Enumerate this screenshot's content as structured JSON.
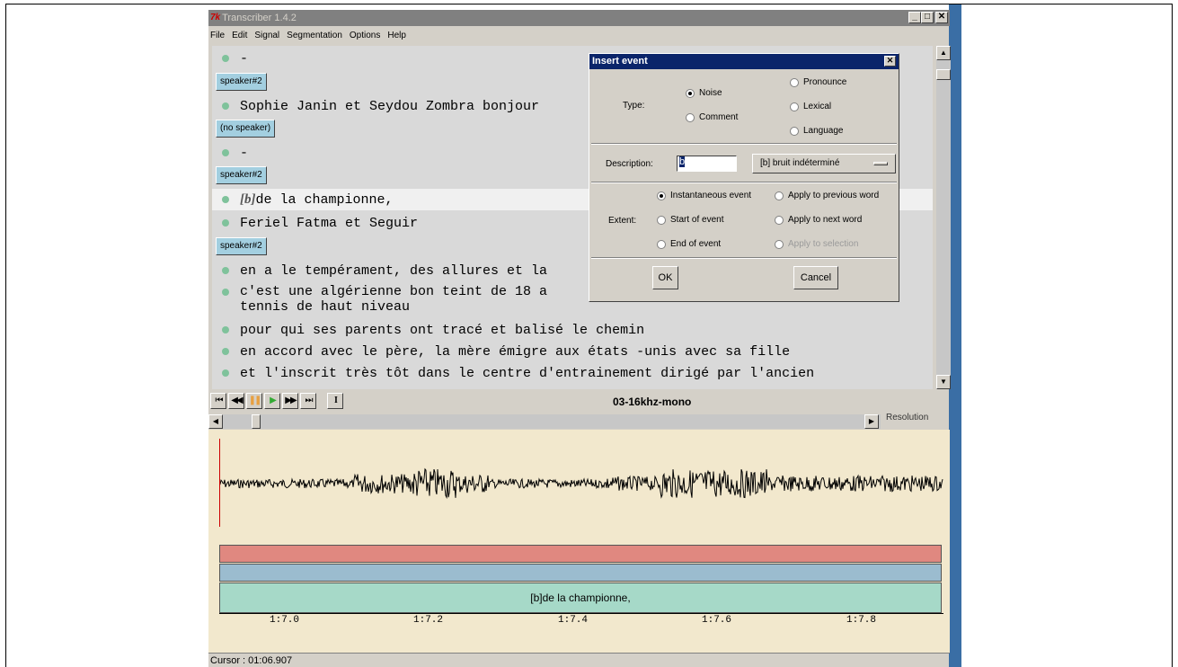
{
  "window": {
    "title": "Transcriber 1.4.2",
    "app_icon": "7k",
    "minimize": "_",
    "maximize": "□",
    "close": "✕"
  },
  "menu": [
    "File",
    "Edit",
    "Signal",
    "Segmentation",
    "Options",
    "Help"
  ],
  "transcript": {
    "lines": [
      {
        "kind": "text",
        "text": "-"
      },
      {
        "kind": "speaker",
        "label": "speaker#2"
      },
      {
        "kind": "text",
        "text": "Sophie Janin et Seydou Zombra bonjour"
      },
      {
        "kind": "speaker",
        "label": "(no speaker)"
      },
      {
        "kind": "text",
        "text": "-"
      },
      {
        "kind": "speaker",
        "label": "speaker#2"
      },
      {
        "kind": "event",
        "event": "[b]",
        "text": "de la championne,"
      },
      {
        "kind": "text",
        "text": "Feriel Fatma et Seguir"
      },
      {
        "kind": "speaker",
        "label": "speaker#2"
      },
      {
        "kind": "text",
        "text": "en a le tempérament, des allures et la"
      },
      {
        "kind": "wrap",
        "text": "c'est une algérienne bon teint de 18 a\ntennis de haut niveau"
      },
      {
        "kind": "text",
        "text": "pour qui ses parents ont tracé et balisé le chemin"
      },
      {
        "kind": "text",
        "text": "en accord avec le père, la mère émigre aux états -unis avec sa fille"
      },
      {
        "kind": "text",
        "text": "et l'inscrit très tôt dans le centre d'entrainement dirigé par l'ancien"
      }
    ]
  },
  "player": {
    "buttons": [
      "⏮",
      "◀◀",
      "❚❚",
      "▶",
      "▶▶",
      "⏭",
      "I"
    ],
    "filename": "03-16khz-mono",
    "resolution_label": "Resolution"
  },
  "segments": {
    "transcription_label": "[b]de la championne,"
  },
  "timeline": {
    "ticks": [
      "1:7.0",
      "1:7.2",
      "1:7.4",
      "1:7.6",
      "1:7.8"
    ]
  },
  "status": {
    "cursor": "Cursor : 01:06.907"
  },
  "dialog": {
    "title": "Insert event",
    "close": "✕",
    "type_label": "Type:",
    "type_options": [
      "Noise",
      "Comment",
      "Pronounce",
      "Lexical",
      "Language"
    ],
    "type_selected": "Noise",
    "description_label": "Description:",
    "description_value": "b",
    "description_menu": "[b] bruit indéterminé",
    "extent_label": "Extent:",
    "extent_options": [
      "Instantaneous event",
      "Start of event",
      "End of event",
      "Apply to previous word",
      "Apply to next word",
      "Apply to selection"
    ],
    "extent_selected": "Instantaneous event",
    "ok": "OK",
    "cancel": "Cancel"
  },
  "colors": {
    "title_inactive": "#808080",
    "dialog_title": "#0a246a",
    "speaker_button": "#a3cfe0",
    "bullet": "#7fc29b",
    "wave_bg": "#f2e8cd",
    "segment_red": "#e08880",
    "segment_blue": "#9bbccf",
    "segment_teal": "#a6d9c8"
  }
}
